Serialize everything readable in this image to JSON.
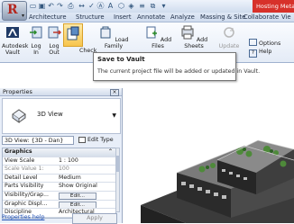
{
  "title_bar": {
    "hosting_label": "Hosting Meta"
  },
  "tabs": [
    {
      "label": "Architecture"
    },
    {
      "label": "Structure"
    },
    {
      "label": "Insert"
    },
    {
      "label": "Annotate"
    },
    {
      "label": "Analyze"
    },
    {
      "label": "Massing & Site"
    },
    {
      "label": "Collaborate"
    },
    {
      "label": "Vie"
    }
  ],
  "ribbon": {
    "buttons": [
      {
        "label": "Autodesk\nVault",
        "icon": "autodesk-vault-icon"
      },
      {
        "label": "Log\nIn",
        "icon": "log-in-icon"
      },
      {
        "label": "Log\nOut",
        "icon": "log-out-icon"
      },
      {
        "label": "Check",
        "icon": "save-to-vault-icon"
      },
      {
        "label": "Load Family",
        "icon": "load-family-icon"
      },
      {
        "label": "Add Files",
        "icon": "add-files-icon"
      },
      {
        "label": "Add Sheets",
        "icon": "add-sheets-icon"
      },
      {
        "label": "Update",
        "icon": "update-icon"
      }
    ],
    "side_items": [
      {
        "label": "Options",
        "icon": "options-icon"
      },
      {
        "label": "Help",
        "icon": "help-icon"
      }
    ]
  },
  "tooltip": {
    "title": "Save to Vault",
    "description": "The current project file will be added or updated in Vault."
  },
  "properties": {
    "title": "Properties",
    "type_name": "3D View",
    "instance_selector": "3D View: {3D - Dan}",
    "edit_type_label": "Edit Type",
    "group_header": "Graphics",
    "rows": [
      {
        "key": "View Scale",
        "value": "1 : 100",
        "kind": "text"
      },
      {
        "key": "Scale Value  1:",
        "value": "100",
        "kind": "dim"
      },
      {
        "key": "Detail Level",
        "value": "Medium",
        "kind": "text"
      },
      {
        "key": "Parts Visibility",
        "value": "Show Original",
        "kind": "text"
      },
      {
        "key": "Visibility/Grap...",
        "value": "Edit...",
        "kind": "button"
      },
      {
        "key": "Graphic Displ...",
        "value": "Edit...",
        "kind": "button"
      },
      {
        "key": "Discipline",
        "value": "Architectural",
        "kind": "text"
      }
    ],
    "help_link": "Properties help",
    "apply_label": "Apply"
  }
}
